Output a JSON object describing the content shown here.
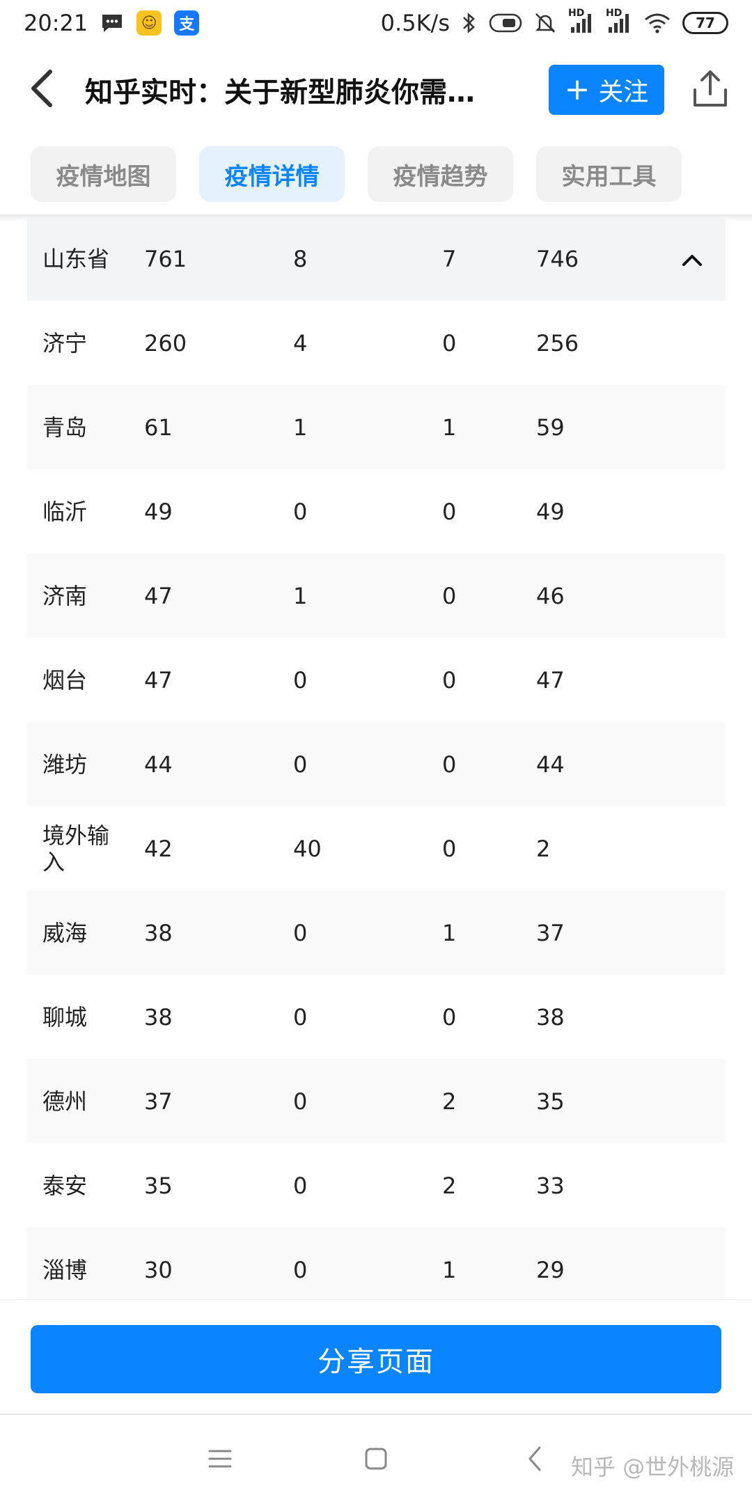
{
  "status_bar": {
    "time": "20:21",
    "net_speed": "0.5K/s",
    "signal_1_label": "HD",
    "signal_2_label": "HD",
    "battery": "77",
    "icons": [
      "message-icon",
      "app-yellow-icon",
      "alipay-icon",
      "bluetooth-icon",
      "toggle-icon",
      "mute-bell-icon",
      "signal-icon",
      "signal-icon",
      "wifi-icon",
      "battery-icon"
    ],
    "alipay_glyph": "支",
    "yellow_glyph": "☺"
  },
  "header": {
    "title": "知乎实时：关于新型肺炎你需…",
    "follow_label": "关注",
    "accent": "#0a84ff"
  },
  "tabs": [
    {
      "label": "疫情地图",
      "active": false
    },
    {
      "label": "疫情详情",
      "active": true
    },
    {
      "label": "疫情趋势",
      "active": false
    },
    {
      "label": "实用工具",
      "active": false
    }
  ],
  "table": {
    "province": {
      "name": "山东省",
      "values": [
        "761",
        "8",
        "7",
        "746"
      ],
      "expanded": true
    },
    "rows": [
      {
        "name": "济宁",
        "values": [
          "260",
          "4",
          "0",
          "256"
        ]
      },
      {
        "name": "青岛",
        "values": [
          "61",
          "1",
          "1",
          "59"
        ]
      },
      {
        "name": "临沂",
        "values": [
          "49",
          "0",
          "0",
          "49"
        ]
      },
      {
        "name": "济南",
        "values": [
          "47",
          "1",
          "0",
          "46"
        ]
      },
      {
        "name": "烟台",
        "values": [
          "47",
          "0",
          "0",
          "47"
        ]
      },
      {
        "name": "潍坊",
        "values": [
          "44",
          "0",
          "0",
          "44"
        ]
      },
      {
        "name": "境外输入",
        "values": [
          "42",
          "40",
          "0",
          "2"
        ]
      },
      {
        "name": "威海",
        "values": [
          "38",
          "0",
          "1",
          "37"
        ]
      },
      {
        "name": "聊城",
        "values": [
          "38",
          "0",
          "0",
          "38"
        ]
      },
      {
        "name": "德州",
        "values": [
          "37",
          "0",
          "2",
          "35"
        ]
      },
      {
        "name": "泰安",
        "values": [
          "35",
          "0",
          "2",
          "33"
        ]
      },
      {
        "name": "淄博",
        "values": [
          "30",
          "0",
          "1",
          "29"
        ]
      }
    ]
  },
  "bottom": {
    "share_label": "分享页面"
  },
  "watermark": "知乎 @世外桃源"
}
